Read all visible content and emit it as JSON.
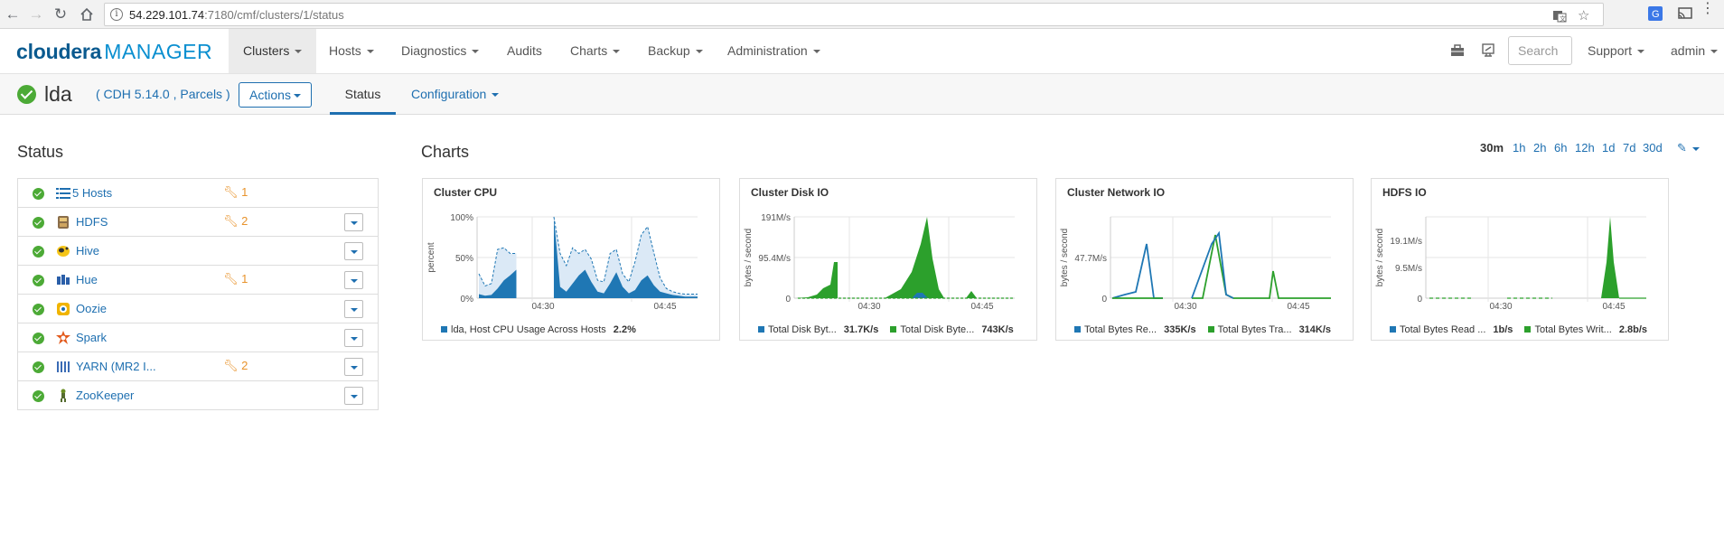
{
  "browser": {
    "url_host": "54.229.101.74",
    "url_rest": ":7180/cmf/clusters/1/status"
  },
  "brand": {
    "part1": "cloudera",
    "part2": "MANAGER"
  },
  "nav": {
    "items": [
      "Clusters",
      "Hosts",
      "Diagnostics",
      "Audits",
      "Charts",
      "Backup",
      "Administration"
    ],
    "search_placeholder": "Search",
    "support": "Support",
    "user": "admin"
  },
  "cluster": {
    "name": "lda",
    "meta": "( CDH 5.14.0 , Parcels )",
    "actions": "Actions",
    "tab_status": "Status",
    "tab_config": "Configuration"
  },
  "status": {
    "title": "Status",
    "services": [
      {
        "name": "5 Hosts",
        "icon": "hosts-list-icon",
        "config_issues": "1",
        "menu": false
      },
      {
        "name": "HDFS",
        "icon": "hdfs-icon",
        "config_issues": "2",
        "menu": true
      },
      {
        "name": "Hive",
        "icon": "hive-icon",
        "config_issues": "",
        "menu": true
      },
      {
        "name": "Hue",
        "icon": "hue-icon",
        "config_issues": "1",
        "menu": true
      },
      {
        "name": "Oozie",
        "icon": "oozie-icon",
        "config_issues": "",
        "menu": true
      },
      {
        "name": "Spark",
        "icon": "spark-icon",
        "config_issues": "",
        "menu": true
      },
      {
        "name": "YARN (MR2 I...",
        "icon": "yarn-icon",
        "config_issues": "2",
        "menu": true
      },
      {
        "name": "ZooKeeper",
        "icon": "zookeeper-icon",
        "config_issues": "",
        "menu": true
      }
    ]
  },
  "charts": {
    "title": "Charts",
    "time_ranges": [
      "30m",
      "1h",
      "2h",
      "6h",
      "12h",
      "1d",
      "7d",
      "30d"
    ],
    "active_range": "30m"
  },
  "colors": {
    "blue": "#1f77b4",
    "green": "#2ca02c",
    "link": "#1e6fb0",
    "ok": "#4caa36",
    "warn": "#e8932c"
  },
  "chart_data": [
    {
      "type": "area",
      "title": "Cluster CPU",
      "ylabel": "percent",
      "yticks": [
        "100%",
        "50%",
        "0%"
      ],
      "xticks": [
        "04:30",
        "04:45"
      ],
      "ylim": [
        0,
        100
      ],
      "x": [
        0,
        1,
        2,
        3,
        4,
        5,
        6,
        7,
        8,
        9,
        10,
        11,
        12,
        13,
        14,
        15,
        16,
        17,
        18,
        19,
        20,
        21,
        22,
        23,
        24,
        25,
        26,
        27,
        28,
        29,
        30,
        31,
        32,
        33,
        34,
        35
      ],
      "series": [
        {
          "name": "lda, Host CPU Usage Across Hosts",
          "legend_value": "2.2%",
          "values": [
            5,
            3,
            4,
            12,
            22,
            28,
            35,
            null,
            null,
            null,
            null,
            null,
            100,
            14,
            8,
            18,
            28,
            35,
            20,
            8,
            6,
            18,
            32,
            14,
            6,
            10,
            22,
            28,
            16,
            8,
            6,
            4,
            3,
            2,
            2,
            2
          ]
        },
        {
          "name": "",
          "values": [
            30,
            15,
            18,
            60,
            62,
            55,
            55,
            null,
            null,
            null,
            null,
            null,
            100,
            55,
            40,
            62,
            55,
            60,
            48,
            22,
            20,
            55,
            60,
            30,
            20,
            45,
            78,
            88,
            56,
            25,
            12,
            8,
            6,
            5,
            5,
            5
          ]
        }
      ]
    },
    {
      "type": "area",
      "title": "Cluster Disk IO",
      "ylabel": "bytes / second",
      "yticks": [
        "191M/s",
        "95.4M/s",
        "0"
      ],
      "xticks": [
        "04:30",
        "04:45"
      ],
      "ylim": [
        0,
        191
      ],
      "series": [
        {
          "name": "Total Disk Byt...",
          "legend_value": "31.7K/s"
        },
        {
          "name": "Total Disk Byte...",
          "legend_value": "743K/s"
        }
      ]
    },
    {
      "type": "line",
      "title": "Cluster Network IO",
      "ylabel": "bytes / second",
      "yticks": [
        "47.7M/s",
        "0"
      ],
      "xticks": [
        "04:30",
        "04:45"
      ],
      "series": [
        {
          "name": "Total Bytes Re...",
          "legend_value": "335K/s"
        },
        {
          "name": "Total Bytes Tra...",
          "legend_value": "314K/s"
        }
      ]
    },
    {
      "type": "area",
      "title": "HDFS IO",
      "ylabel": "bytes / second",
      "yticks": [
        "19.1M/s",
        "9.5M/s",
        "0"
      ],
      "xticks": [
        "04:30",
        "04:45"
      ],
      "series": [
        {
          "name": "Total Bytes Read ...",
          "legend_value": "1b/s"
        },
        {
          "name": "Total Bytes Writ...",
          "legend_value": "2.8b/s"
        }
      ]
    }
  ]
}
